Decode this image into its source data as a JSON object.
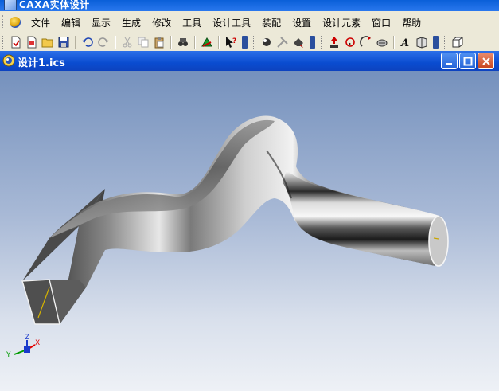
{
  "app": {
    "title": "CAXA实体设计"
  },
  "menu": {
    "items": [
      "文件",
      "编辑",
      "显示",
      "生成",
      "修改",
      "工具",
      "设计工具",
      "装配",
      "设置",
      "设计元素",
      "窗口",
      "帮助"
    ]
  },
  "toolbar": {
    "buttons": [
      "new-icon",
      "open-recent-icon",
      "open-folder-icon",
      "save-icon",
      "undo-icon",
      "redo-icon",
      "cut-icon",
      "copy-icon",
      "paste-icon",
      "search-binoculars-icon",
      "design-tree-icon",
      "help-pointer-icon",
      "smart-render-icon",
      "tools-icon",
      "paint-icon",
      "move-icon",
      "rotate-icon",
      "spin-icon",
      "zoom-icon",
      "text-icon",
      "view-icon",
      "box-icon"
    ]
  },
  "document_window": {
    "title": "设计1.ics",
    "minimize_label": "–",
    "restore_label": "□",
    "close_label": "×"
  },
  "axes": {
    "x": "X",
    "y": "Y",
    "z": "Z"
  },
  "colors": {
    "viewport_top": "#7591bd",
    "viewport_bottom": "#eef1f6",
    "title_bar": "#0a4cd0",
    "axis_x": "#e00000",
    "axis_y": "#009a00",
    "axis_z": "#1a3acc"
  }
}
